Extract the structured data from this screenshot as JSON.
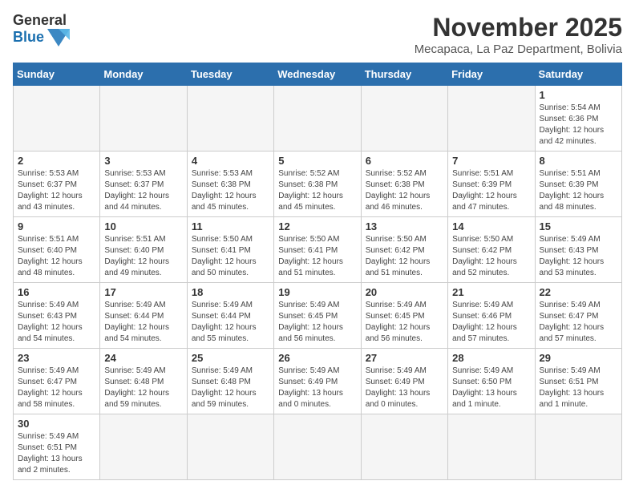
{
  "logo": {
    "line1": "General",
    "line2": "Blue"
  },
  "title": "November 2025",
  "subtitle": "Mecapaca, La Paz Department, Bolivia",
  "days_of_week": [
    "Sunday",
    "Monday",
    "Tuesday",
    "Wednesday",
    "Thursday",
    "Friday",
    "Saturday"
  ],
  "weeks": [
    [
      {
        "day": "",
        "info": ""
      },
      {
        "day": "",
        "info": ""
      },
      {
        "day": "",
        "info": ""
      },
      {
        "day": "",
        "info": ""
      },
      {
        "day": "",
        "info": ""
      },
      {
        "day": "",
        "info": ""
      },
      {
        "day": "1",
        "info": "Sunrise: 5:54 AM\nSunset: 6:36 PM\nDaylight: 12 hours\nand 42 minutes."
      }
    ],
    [
      {
        "day": "2",
        "info": "Sunrise: 5:53 AM\nSunset: 6:37 PM\nDaylight: 12 hours\nand 43 minutes."
      },
      {
        "day": "3",
        "info": "Sunrise: 5:53 AM\nSunset: 6:37 PM\nDaylight: 12 hours\nand 44 minutes."
      },
      {
        "day": "4",
        "info": "Sunrise: 5:53 AM\nSunset: 6:38 PM\nDaylight: 12 hours\nand 45 minutes."
      },
      {
        "day": "5",
        "info": "Sunrise: 5:52 AM\nSunset: 6:38 PM\nDaylight: 12 hours\nand 45 minutes."
      },
      {
        "day": "6",
        "info": "Sunrise: 5:52 AM\nSunset: 6:38 PM\nDaylight: 12 hours\nand 46 minutes."
      },
      {
        "day": "7",
        "info": "Sunrise: 5:51 AM\nSunset: 6:39 PM\nDaylight: 12 hours\nand 47 minutes."
      },
      {
        "day": "8",
        "info": "Sunrise: 5:51 AM\nSunset: 6:39 PM\nDaylight: 12 hours\nand 48 minutes."
      }
    ],
    [
      {
        "day": "9",
        "info": "Sunrise: 5:51 AM\nSunset: 6:40 PM\nDaylight: 12 hours\nand 48 minutes."
      },
      {
        "day": "10",
        "info": "Sunrise: 5:51 AM\nSunset: 6:40 PM\nDaylight: 12 hours\nand 49 minutes."
      },
      {
        "day": "11",
        "info": "Sunrise: 5:50 AM\nSunset: 6:41 PM\nDaylight: 12 hours\nand 50 minutes."
      },
      {
        "day": "12",
        "info": "Sunrise: 5:50 AM\nSunset: 6:41 PM\nDaylight: 12 hours\nand 51 minutes."
      },
      {
        "day": "13",
        "info": "Sunrise: 5:50 AM\nSunset: 6:42 PM\nDaylight: 12 hours\nand 51 minutes."
      },
      {
        "day": "14",
        "info": "Sunrise: 5:50 AM\nSunset: 6:42 PM\nDaylight: 12 hours\nand 52 minutes."
      },
      {
        "day": "15",
        "info": "Sunrise: 5:49 AM\nSunset: 6:43 PM\nDaylight: 12 hours\nand 53 minutes."
      }
    ],
    [
      {
        "day": "16",
        "info": "Sunrise: 5:49 AM\nSunset: 6:43 PM\nDaylight: 12 hours\nand 54 minutes."
      },
      {
        "day": "17",
        "info": "Sunrise: 5:49 AM\nSunset: 6:44 PM\nDaylight: 12 hours\nand 54 minutes."
      },
      {
        "day": "18",
        "info": "Sunrise: 5:49 AM\nSunset: 6:44 PM\nDaylight: 12 hours\nand 55 minutes."
      },
      {
        "day": "19",
        "info": "Sunrise: 5:49 AM\nSunset: 6:45 PM\nDaylight: 12 hours\nand 56 minutes."
      },
      {
        "day": "20",
        "info": "Sunrise: 5:49 AM\nSunset: 6:45 PM\nDaylight: 12 hours\nand 56 minutes."
      },
      {
        "day": "21",
        "info": "Sunrise: 5:49 AM\nSunset: 6:46 PM\nDaylight: 12 hours\nand 57 minutes."
      },
      {
        "day": "22",
        "info": "Sunrise: 5:49 AM\nSunset: 6:47 PM\nDaylight: 12 hours\nand 57 minutes."
      }
    ],
    [
      {
        "day": "23",
        "info": "Sunrise: 5:49 AM\nSunset: 6:47 PM\nDaylight: 12 hours\nand 58 minutes."
      },
      {
        "day": "24",
        "info": "Sunrise: 5:49 AM\nSunset: 6:48 PM\nDaylight: 12 hours\nand 59 minutes."
      },
      {
        "day": "25",
        "info": "Sunrise: 5:49 AM\nSunset: 6:48 PM\nDaylight: 12 hours\nand 59 minutes."
      },
      {
        "day": "26",
        "info": "Sunrise: 5:49 AM\nSunset: 6:49 PM\nDaylight: 13 hours\nand 0 minutes."
      },
      {
        "day": "27",
        "info": "Sunrise: 5:49 AM\nSunset: 6:49 PM\nDaylight: 13 hours\nand 0 minutes."
      },
      {
        "day": "28",
        "info": "Sunrise: 5:49 AM\nSunset: 6:50 PM\nDaylight: 13 hours\nand 1 minute."
      },
      {
        "day": "29",
        "info": "Sunrise: 5:49 AM\nSunset: 6:51 PM\nDaylight: 13 hours\nand 1 minute."
      }
    ],
    [
      {
        "day": "30",
        "info": "Sunrise: 5:49 AM\nSunset: 6:51 PM\nDaylight: 13 hours\nand 2 minutes."
      },
      {
        "day": "",
        "info": ""
      },
      {
        "day": "",
        "info": ""
      },
      {
        "day": "",
        "info": ""
      },
      {
        "day": "",
        "info": ""
      },
      {
        "day": "",
        "info": ""
      },
      {
        "day": "",
        "info": ""
      }
    ]
  ]
}
